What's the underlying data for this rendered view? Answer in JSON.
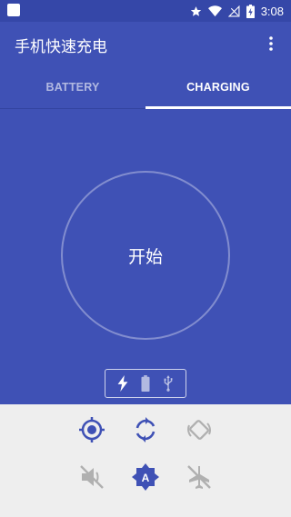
{
  "status_bar": {
    "time": "3:08",
    "icons": [
      "notification-square-icon",
      "star-icon",
      "wifi-icon",
      "signal-off-icon",
      "battery-charging-icon"
    ]
  },
  "app_bar": {
    "title": "手机快速充电",
    "menu_icon": "more-vertical-icon"
  },
  "tabs": [
    {
      "label": "BATTERY",
      "selected": false
    },
    {
      "label": "CHARGING",
      "selected": true
    }
  ],
  "main": {
    "start_label": "开始",
    "charge_mode_icons": [
      "lightning-icon",
      "battery-icon",
      "usb-icon"
    ]
  },
  "controls": {
    "row1": [
      "location-target-icon",
      "sync-icon",
      "screen-rotation-icon"
    ],
    "row2": [
      "sound-off-icon",
      "auto-brightness-icon",
      "airplane-mode-icon"
    ]
  },
  "colors": {
    "primary": "#3f51b5",
    "primary_dark": "#3547a8",
    "active_control": "#3f51b5",
    "inactive_control": "#b0b0b0",
    "controls_background": "#eeeeee"
  }
}
